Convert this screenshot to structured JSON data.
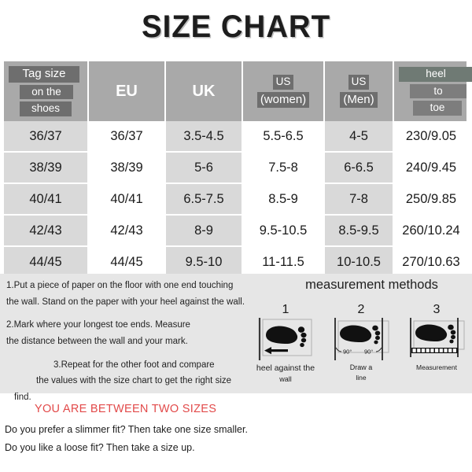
{
  "title": "SIZE CHART",
  "table": {
    "headers": [
      {
        "type": "stacked",
        "lines": [
          "Tag size",
          "on the",
          "shoes"
        ]
      },
      {
        "type": "plain",
        "label": "EU"
      },
      {
        "type": "plain",
        "label": "UK"
      },
      {
        "type": "stacked",
        "lines": [
          "US",
          "(women)"
        ]
      },
      {
        "type": "stacked",
        "lines": [
          "US",
          "(Men)"
        ]
      },
      {
        "type": "stacked",
        "lines": [
          "heel",
          "to",
          "toe"
        ]
      }
    ],
    "rows": [
      [
        "36/37",
        "36/37",
        "3.5-4.5",
        "5.5-6.5",
        "4-5",
        "230/9.05"
      ],
      [
        "38/39",
        "38/39",
        "5-6",
        "7.5-8",
        "6-6.5",
        "240/9.45"
      ],
      [
        "40/41",
        "40/41",
        "6.5-7.5",
        "8.5-9",
        "7-8",
        "250/9.85"
      ],
      [
        "42/43",
        "42/43",
        "8-9",
        "9.5-10.5",
        "8.5-9.5",
        "260/10.24"
      ],
      [
        "44/45",
        "44/45",
        "9.5-10",
        "11-11.5",
        "10-10.5",
        "270/10.63"
      ]
    ]
  },
  "instructions": {
    "line1": "1.Put a piece of paper on the floor with one end touching",
    "line2": "the wall. Stand on the paper with your heel against the wall.",
    "line3": "2.Mark where your longest toe ends. Measure",
    "line4": "the distance between the wall and your mark.",
    "line5": "3.Repeat for the other foot and compare",
    "line6": "the values with the size chart to get the right size",
    "line7": "find."
  },
  "measurement": {
    "title": "measurement methods",
    "diagrams": [
      {
        "number": "1",
        "caption_line1": "heel against the",
        "caption_line2": "wall",
        "angle_left": "",
        "angle_right": ""
      },
      {
        "number": "2",
        "caption_line1": "Draw a",
        "caption_line2": "line",
        "angle_left": "90°",
        "angle_right": "90°"
      },
      {
        "number": "3",
        "caption_line1": "Measurement",
        "caption_line2": "",
        "angle_left": "",
        "angle_right": ""
      }
    ]
  },
  "bottom": {
    "heading": "YOU ARE BETWEEN TWO SIZES",
    "line1": "Do you prefer a slimmer fit? Then take one size smaller.",
    "line2": "Do you like a loose fit? Then take a size up."
  },
  "colors": {
    "header_bg": "#a9a9a9",
    "highlight": "#6e6e6e",
    "highlight_green": "#6f7a74",
    "row_shade": "#d9d9d9",
    "panel_bg": "#e6e6e6",
    "accent_red": "#e24a4a"
  }
}
